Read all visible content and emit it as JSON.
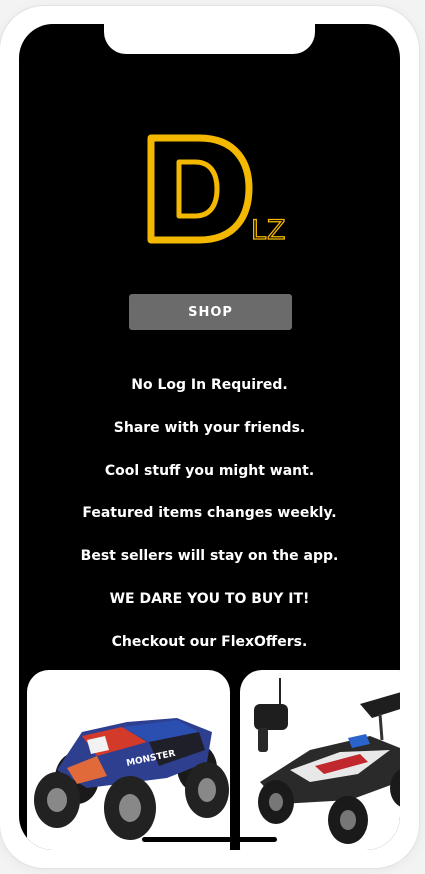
{
  "brand": {
    "logo_letter": "D",
    "logo_suffix": "LZ",
    "accent_color": "#F5B800"
  },
  "shop_button": {
    "label": "SHOP"
  },
  "info_lines": [
    "No Log In Required.",
    "Share with your friends.",
    "Cool stuff you might want.",
    "Featured items changes weekly.",
    "Best sellers will stay on the app.",
    "WE DARE YOU TO BUY IT!",
    "Checkout our FlexOffers."
  ],
  "products": [
    {
      "image": "rc-monster-truck-image"
    },
    {
      "image": "rc-buggy-with-controller-image"
    }
  ]
}
